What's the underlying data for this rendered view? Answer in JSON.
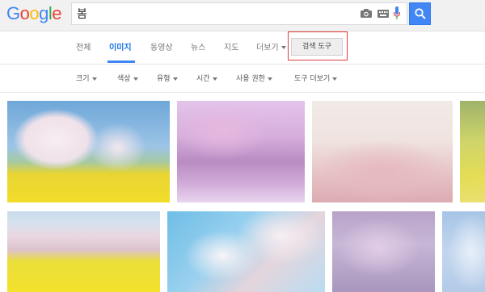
{
  "logo": {
    "text": "Google",
    "letters": [
      {
        "ch": "G",
        "color": "#4285f4"
      },
      {
        "ch": "o",
        "color": "#ea4335"
      },
      {
        "ch": "o",
        "color": "#fbbc05"
      },
      {
        "ch": "g",
        "color": "#4285f4"
      },
      {
        "ch": "l",
        "color": "#34a853"
      },
      {
        "ch": "e",
        "color": "#ea4335"
      }
    ]
  },
  "search": {
    "query": "봄"
  },
  "tabs": [
    {
      "label": "전체"
    },
    {
      "label": "이미지",
      "active": true
    },
    {
      "label": "동영상"
    },
    {
      "label": "뉴스"
    },
    {
      "label": "지도"
    },
    {
      "label": "더보기"
    }
  ],
  "tools_button": "검색 도구",
  "filters": [
    "크기",
    "색상",
    "유형",
    "시간",
    "사용 권한",
    "도구 더보기"
  ],
  "colors": {
    "accent": "#4285f4",
    "highlight": "#e23b3b"
  },
  "icons": [
    "camera-icon",
    "keyboard-icon",
    "mic-icon",
    "search-icon"
  ]
}
